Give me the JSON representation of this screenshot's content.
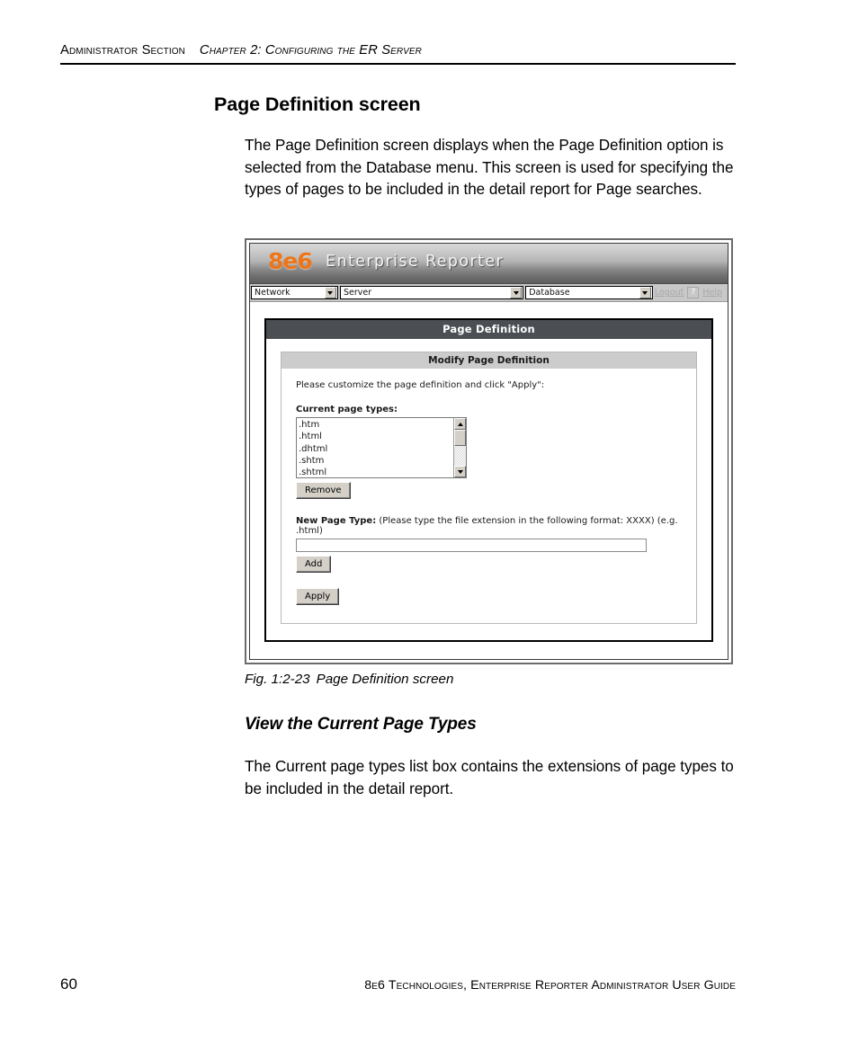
{
  "header": {
    "section": "Administrator Section",
    "chapter": "Chapter 2: Configuring the ER Server"
  },
  "heading": "Page Definition screen",
  "intro_paragraph": "The Page Definition screen displays when the Page Definition option is selected from the Database menu. This screen is used for specifying the types of pages to be included in the detail report for Page searches.",
  "figure": {
    "number": "Fig. 1:2-23",
    "caption": "Page Definition screen"
  },
  "subheading": "View the Current Page Types",
  "subsection_paragraph": "The Current page types list box contains the extensions of page types to be included in the detail report.",
  "footer": {
    "page_number": "60",
    "text": "8e6 Technologies, Enterprise Reporter Administrator User Guide"
  },
  "screenshot": {
    "app": {
      "logo_mark": "8e6",
      "logo_text": "Enterprise Reporter",
      "logo_color": "#ee7518",
      "menus": [
        {
          "label": "Network"
        },
        {
          "label": "Server"
        },
        {
          "label": "Database"
        }
      ],
      "logout_label": "Logout",
      "help_icon_label": "?",
      "help_label": "Help"
    },
    "panel": {
      "title": "Page Definition",
      "card_title": "Modify Page Definition",
      "instruction": "Please customize the page definition and click \"Apply\":",
      "current_types_label": "Current page types:",
      "current_types": [
        ".htm",
        ".html",
        ".dhtml",
        ".shtm",
        ".shtml"
      ],
      "remove_label": "Remove",
      "new_page_type_label": "New Page Type:",
      "new_page_type_hint": "(Please type the file extension in the following format: XXXX) (e.g. .html)",
      "new_page_type_value": "",
      "add_label": "Add",
      "apply_label": "Apply"
    }
  }
}
